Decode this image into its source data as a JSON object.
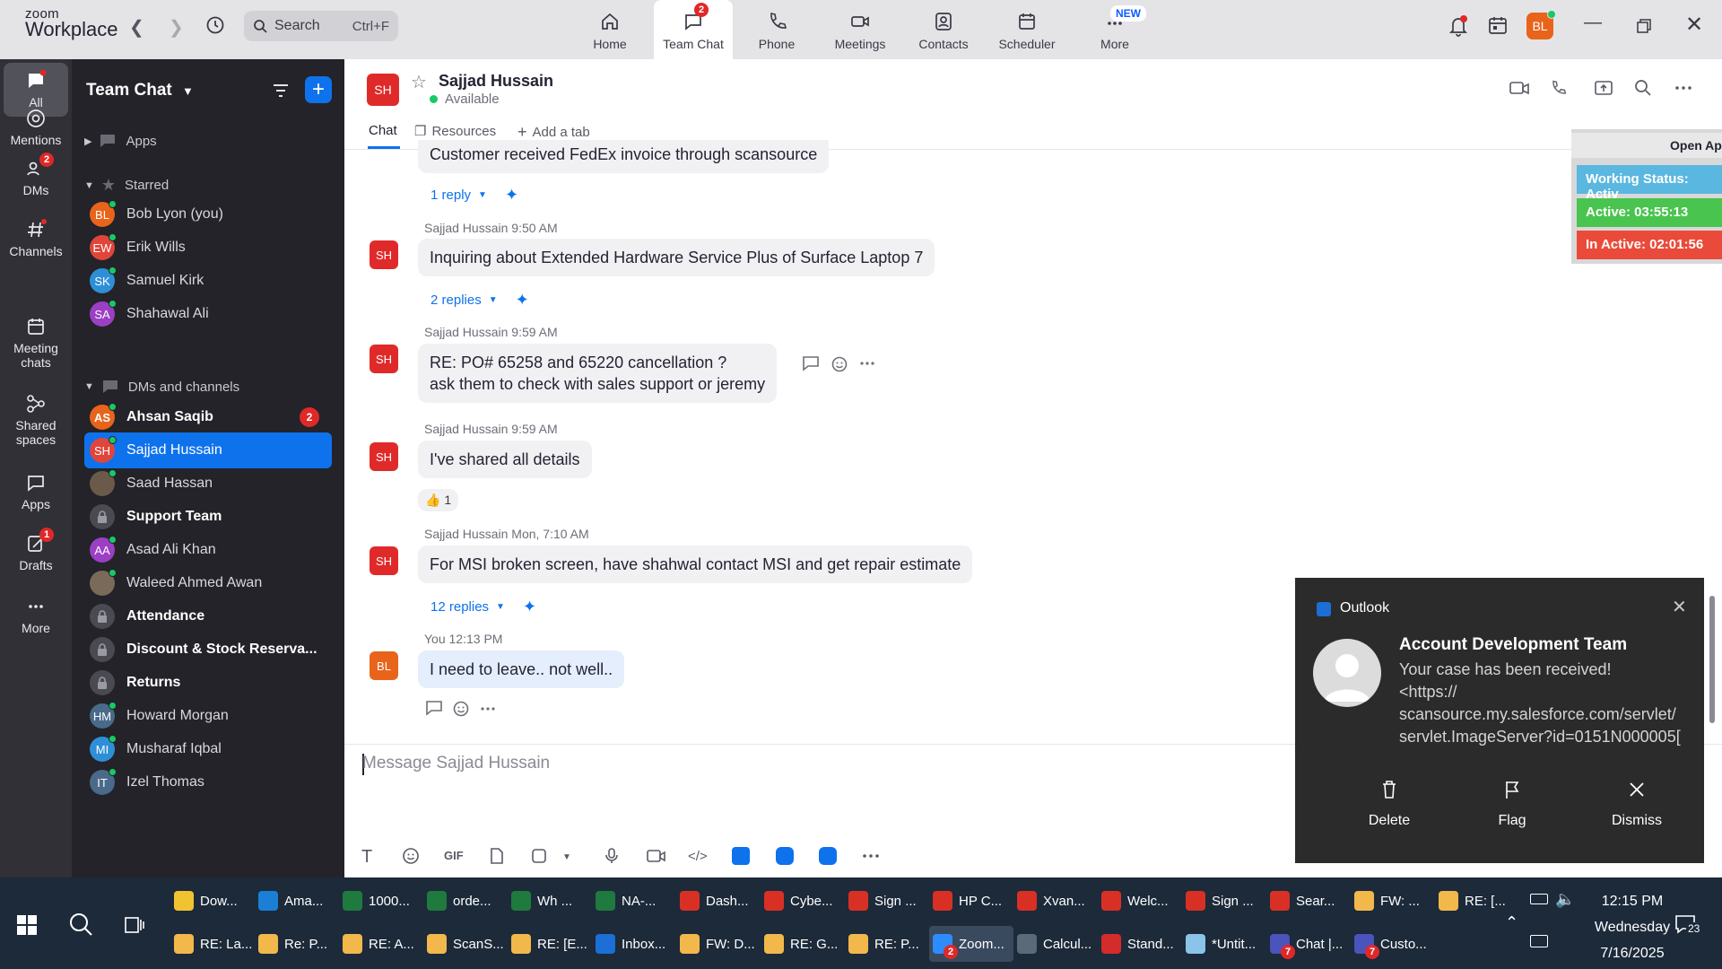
{
  "app": {
    "logo_top": "zoom",
    "logo_bottom": "Workplace"
  },
  "search": {
    "label": "Search",
    "shortcut": "Ctrl+F"
  },
  "tabs": [
    {
      "label": "Home",
      "icon": "home-icon"
    },
    {
      "label": "Team Chat",
      "icon": "chat-icon",
      "badge": "2"
    },
    {
      "label": "Phone",
      "icon": "phone-icon"
    },
    {
      "label": "Meetings",
      "icon": "video-icon"
    },
    {
      "label": "Contacts",
      "icon": "contacts-icon"
    },
    {
      "label": "Scheduler",
      "icon": "calendar-icon"
    },
    {
      "label": "More",
      "icon": "more-icon",
      "new_badge": "NEW"
    }
  ],
  "user_avatar": "BL",
  "rail": [
    {
      "label": "All"
    },
    {
      "label": "Mentions"
    },
    {
      "label": "DMs",
      "badge": "2"
    },
    {
      "label": "Channels"
    },
    {
      "label": "Meeting chats"
    },
    {
      "label": "Shared spaces"
    },
    {
      "label": "Apps"
    },
    {
      "label": "Drafts",
      "badge": "1"
    },
    {
      "label": "More"
    }
  ],
  "sidebar": {
    "title": "Team Chat",
    "apps_label": "Apps",
    "starred_label": "Starred",
    "starred": [
      {
        "initials": "BL",
        "name": "Bob Lyon (you)",
        "color": "#e8641b"
      },
      {
        "initials": "EW",
        "name": "Erik Wills",
        "color": "#e0453c"
      },
      {
        "initials": "SK",
        "name": "Samuel Kirk",
        "color": "#2f8fd6"
      },
      {
        "initials": "SA",
        "name": "Shahawal Ali",
        "color": "#9b3fc4"
      }
    ],
    "dms_label": "DMs and channels",
    "dms": [
      {
        "initials": "AS",
        "name": "Ahsan Saqib",
        "color": "#e8641b",
        "count": "2"
      },
      {
        "initials": "SH",
        "name": "Sajjad Hussain",
        "color": "#e0453c"
      },
      {
        "initials": "",
        "name": "Saad Hassan",
        "color": "#6b5a4a"
      },
      {
        "initials": "",
        "name": "Support Team",
        "lock": true
      },
      {
        "initials": "AA",
        "name": "Asad Ali Khan",
        "color": "#9b3fc4"
      },
      {
        "initials": "",
        "name": "Waleed Ahmed Awan",
        "color": "#7a6a5a"
      },
      {
        "initials": "",
        "name": "Attendance",
        "lock": true
      },
      {
        "initials": "",
        "name": "Discount & Stock Reserva...",
        "lock": true
      },
      {
        "initials": "",
        "name": "Returns",
        "lock": true
      },
      {
        "initials": "HM",
        "name": "Howard Morgan",
        "color": "#4a6a8a"
      },
      {
        "initials": "MI",
        "name": "Musharaf Iqbal",
        "color": "#2f8fd6"
      },
      {
        "initials": "IT",
        "name": "Izel Thomas",
        "color": "#4a6a8a"
      }
    ]
  },
  "chat": {
    "avatar": "SH",
    "name": "Sajjad Hussain",
    "status": "Available",
    "tabs": [
      "Chat",
      "Resources",
      "Add a tab"
    ],
    "prev_bubble": "Customer received FedEx invoice through scansource",
    "prev_replies": "1 reply",
    "messages": [
      {
        "author": "Sajjad Hussain",
        "time": "9:50 AM",
        "avatar": "SH",
        "text": "Inquiring about Extended Hardware Service Plus of Surface Laptop 7",
        "replies": "2 replies"
      },
      {
        "author": "Sajjad Hussain",
        "time": "9:59 AM",
        "avatar": "SH",
        "line1": "RE: PO# 65258 and 65220 cancellation ?",
        "line2": "ask them to check with sales support or jeremy"
      },
      {
        "author": "Sajjad Hussain",
        "time": "9:59 AM",
        "avatar": "SH",
        "text": "I've shared all details",
        "reaction": "1"
      },
      {
        "author": "Sajjad Hussain",
        "time": "Mon, 7:10 AM",
        "avatar": "SH",
        "text": "For MSI broken screen, have shahwal contact MSI and get repair estimate",
        "replies": "12 replies"
      },
      {
        "author": "You",
        "time": "12:13 PM",
        "avatar": "BL",
        "text": "I need to leave.. not well.."
      }
    ],
    "composer_placeholder": "Message Sajjad Hussain"
  },
  "overlay": {
    "header": "Open Ap",
    "working": "Working Status: Activ",
    "active": "Active: 03:55:13",
    "inactive": "In Active: 02:01:56"
  },
  "toast": {
    "app": "Outlook",
    "title": "Account Development Team",
    "line1": "Your case has been received!",
    "line2": "<https://",
    "line3": "scansource.my.salesforce.com/servlet/",
    "line4": "servlet.ImageServer?id=0151N000005[",
    "actions": [
      "Delete",
      "Flag",
      "Dismiss"
    ]
  },
  "taskbar": {
    "row1": [
      {
        "label": "Dow...",
        "color": "#f2c330"
      },
      {
        "label": "Ama...",
        "color": "#1b7fd6"
      },
      {
        "label": "1000...",
        "color": "#1f7a3e"
      },
      {
        "label": "orde...",
        "color": "#1f7a3e"
      },
      {
        "label": "Wh ...",
        "color": "#1f7a3e"
      },
      {
        "label": "NA-...",
        "color": "#1f7a3e"
      },
      {
        "label": "Dash...",
        "color": "#d93025"
      },
      {
        "label": "Cybe...",
        "color": "#d93025"
      },
      {
        "label": "Sign ...",
        "color": "#d93025"
      },
      {
        "label": "HP C...",
        "color": "#d93025"
      },
      {
        "label": "Xvan...",
        "color": "#d93025"
      },
      {
        "label": "Welc...",
        "color": "#d93025"
      },
      {
        "label": "Sign ...",
        "color": "#d93025"
      },
      {
        "label": "Sear...",
        "color": "#d93025"
      },
      {
        "label": "FW: ...",
        "color": "#f2b84b"
      },
      {
        "label": "RE: [...",
        "color": "#f2b84b"
      }
    ],
    "row2": [
      {
        "label": "RE: La...",
        "color": "#f2b84b"
      },
      {
        "label": "Re: P...",
        "color": "#f2b84b"
      },
      {
        "label": "RE: A...",
        "color": "#f2b84b"
      },
      {
        "label": "ScanS...",
        "color": "#f2b84b"
      },
      {
        "label": "RE: [E...",
        "color": "#f2b84b"
      },
      {
        "label": "Inbox...",
        "color": "#1b6fd6"
      },
      {
        "label": "FW: D...",
        "color": "#f2b84b"
      },
      {
        "label": "RE: G...",
        "color": "#f2b84b"
      },
      {
        "label": "RE: P...",
        "color": "#f2b84b"
      },
      {
        "label": "Zoom...",
        "color": "#2d8cff",
        "badge": "2"
      },
      {
        "label": "Calcul...",
        "color": "#5a6a7a"
      },
      {
        "label": "Stand...",
        "color": "#d42b2b"
      },
      {
        "label": "*Untit...",
        "color": "#8ac4e8"
      },
      {
        "label": "Chat |...",
        "color": "#4b53bc",
        "badge": "7"
      },
      {
        "label": "Custo...",
        "color": "#4b53bc",
        "badge": "7"
      }
    ],
    "time": "12:15 PM",
    "day": "Wednesday",
    "date": "7/16/2025",
    "notif_count": "23"
  }
}
